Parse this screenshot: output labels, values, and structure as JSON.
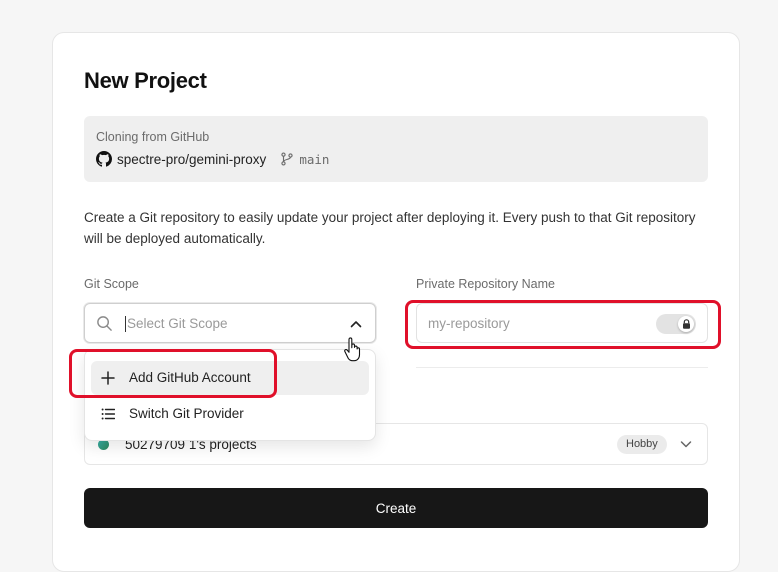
{
  "page": {
    "title": "New Project",
    "clone": {
      "label": "Cloning from GitHub",
      "repo": "spectre-pro/gemini-proxy",
      "branch": "main"
    },
    "description": "Create a Git repository to easily update your project after deploying it. Every push to that Git repository will be deployed automatically."
  },
  "git_scope": {
    "label": "Git Scope",
    "placeholder": "Select Git Scope",
    "icon": "search-icon"
  },
  "repo_name": {
    "label": "Private Repository Name",
    "placeholder": "my-repository",
    "private_toggle_on": true,
    "icon": "lock-icon"
  },
  "dropdown": {
    "items": [
      {
        "label": "Add GitHub Account",
        "icon": "plus-icon",
        "highlighted": true
      },
      {
        "label": "Switch Git Provider",
        "icon": "list-icon",
        "highlighted": false
      }
    ]
  },
  "team": {
    "name": "50279709 1's projects",
    "plan": "Hobby"
  },
  "actions": {
    "create_label": "Create"
  },
  "colors": {
    "annotation": "#e0102a",
    "primary_button": "#171717",
    "page_bg": "#f6f6f6"
  }
}
